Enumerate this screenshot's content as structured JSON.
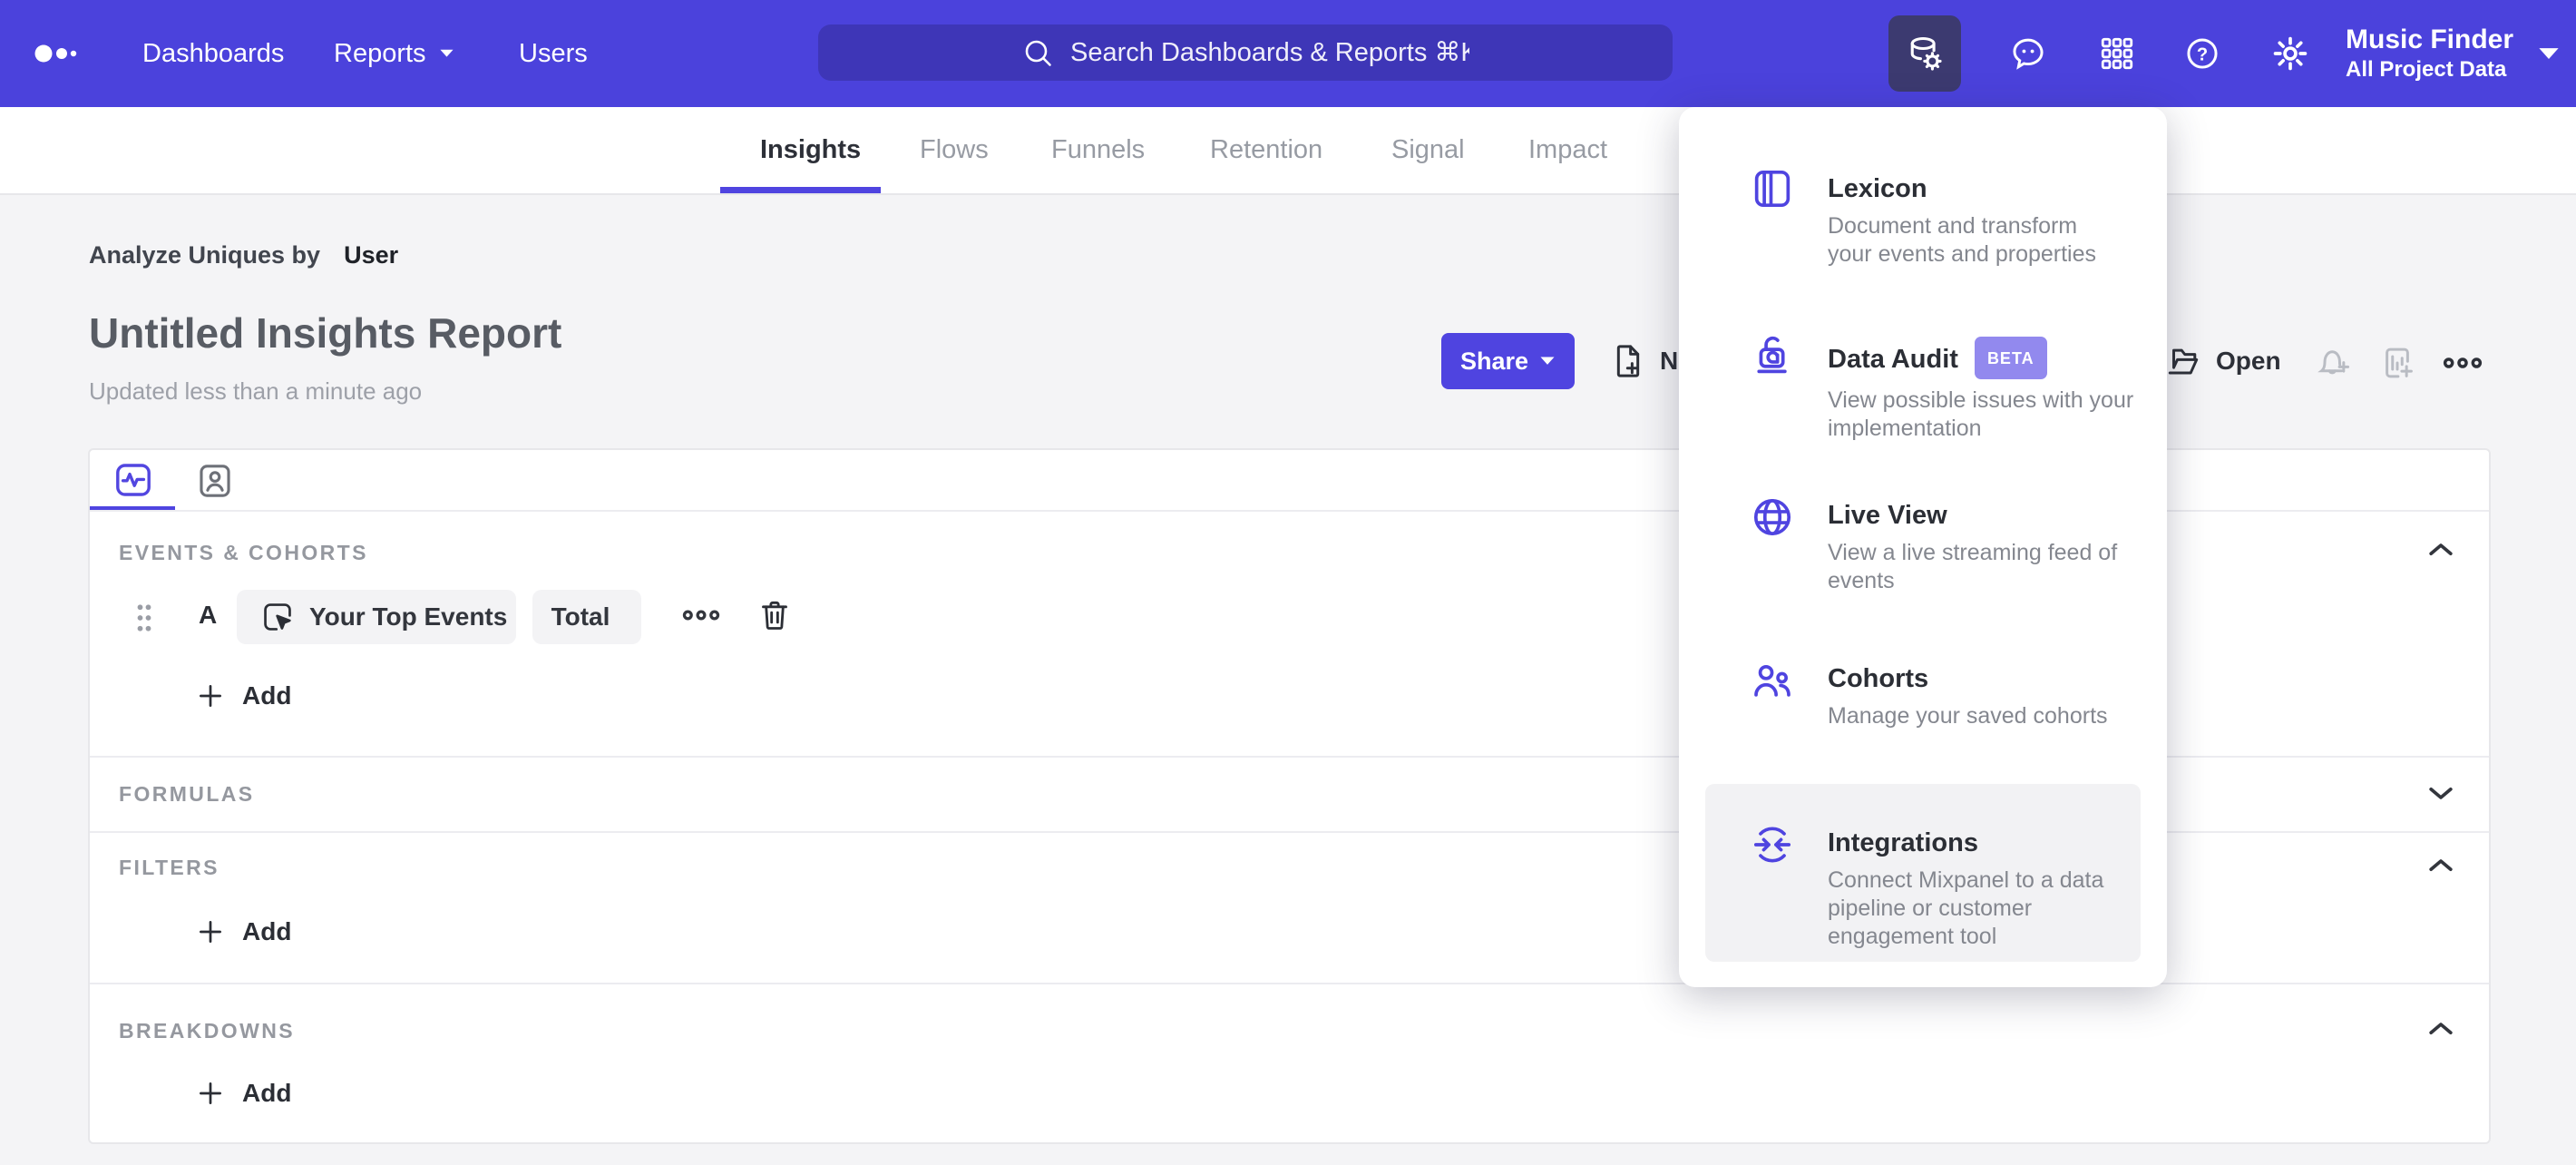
{
  "app": {
    "accent_color": "#4F44E0",
    "nav_color": "#4B42DC"
  },
  "nav": {
    "items": [
      {
        "label": "Dashboards"
      },
      {
        "label": "Reports"
      },
      {
        "label": "Users"
      }
    ],
    "search_placeholder": "Search Dashboards & Reports ⌘K",
    "project": {
      "name": "Music Finder",
      "scope": "All Project Data"
    }
  },
  "tabs": [
    {
      "label": "Insights"
    },
    {
      "label": "Flows"
    },
    {
      "label": "Funnels"
    },
    {
      "label": "Retention"
    },
    {
      "label": "Signal"
    },
    {
      "label": "Impact"
    }
  ],
  "report": {
    "analyze_label": "Analyze Uniques by",
    "analyze_value": "User",
    "title": "Untitled Insights Report",
    "updated": "Updated less than a minute ago"
  },
  "toolbar": {
    "share_label": "Share",
    "new_label": "New",
    "open_label": "Open"
  },
  "builder": {
    "events_section": "EVENTS & COHORTS",
    "formulas_section": "FORMULAS",
    "filters_section": "FILTERS",
    "breakdowns_section": "BREAKDOWNS",
    "row_letter": "A",
    "event_name": "Your Top Events",
    "aggregation": "Total",
    "add_label": "Add"
  },
  "menu": {
    "items": [
      {
        "title": "Lexicon",
        "desc": "Document and transform\nyour events and properties"
      },
      {
        "title": "Data Audit",
        "badge": "BETA",
        "desc": "View possible issues with your\nimplementation"
      },
      {
        "title": "Live View",
        "desc": "View a live streaming feed of\nevents"
      },
      {
        "title": "Cohorts",
        "desc": "Manage your saved cohorts"
      },
      {
        "title": "Integrations",
        "desc": "Connect Mixpanel to a data\npipeline or customer\nengagement tool"
      }
    ]
  }
}
